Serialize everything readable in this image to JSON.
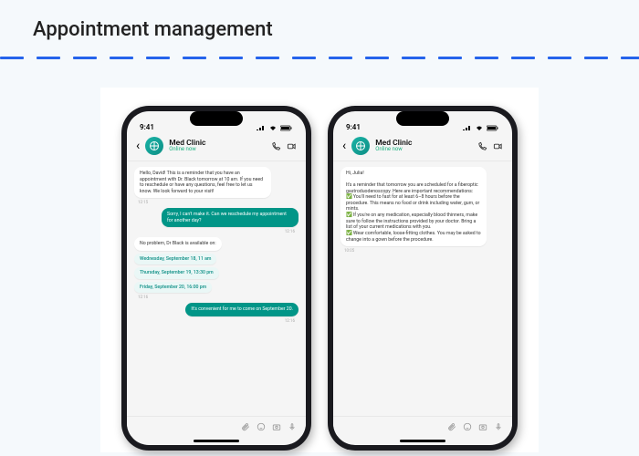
{
  "section_title": "Appointment management",
  "status_bar": {
    "time": "9:41"
  },
  "chat_header": {
    "name": "Med Clinic",
    "status": "Online now"
  },
  "phone1": {
    "m1": "Hello, David! This is a reminder that you have an appointment with Dr. Black tomorrow at 10 am. If you need to reschedule or have any questions, feel free to let us know. We look forward to your visit!",
    "t1": "12:15",
    "m2": "Sorry, I can't make it. Can we reschedule my appointment for another day?",
    "t2": "12:16",
    "m3": "No problem, Dr Black is available on:",
    "opt1": "Wednesday, September 18, 11 am",
    "opt2": "Thursday, September 19, 13:30 pm",
    "opt3": "Friday, September 20, 16:00 pm",
    "t3": "12:16",
    "m4": "It's convenient for me to come on September 20.",
    "t4": "12:16"
  },
  "phone2": {
    "m1a": "Hi, Julia!",
    "m1b": "It's a reminder that tomorrow you are scheduled for a fiberoptic gastroduodenoscopy. Here are important recommendations:",
    "c1": "You'll need to fast for at least 6–8 hours before the procedure. This means no food or drink including water, gum, or mints.",
    "c2": "If you're on any medication, especially blood thinners, make sure to follow the instructions provided by your doctor. Bring a list of your current medications with you.",
    "c3": "Wear comfortable, loose-fitting clothes. You may be asked to change into a gown before the procedure.",
    "t1": "10:05"
  }
}
